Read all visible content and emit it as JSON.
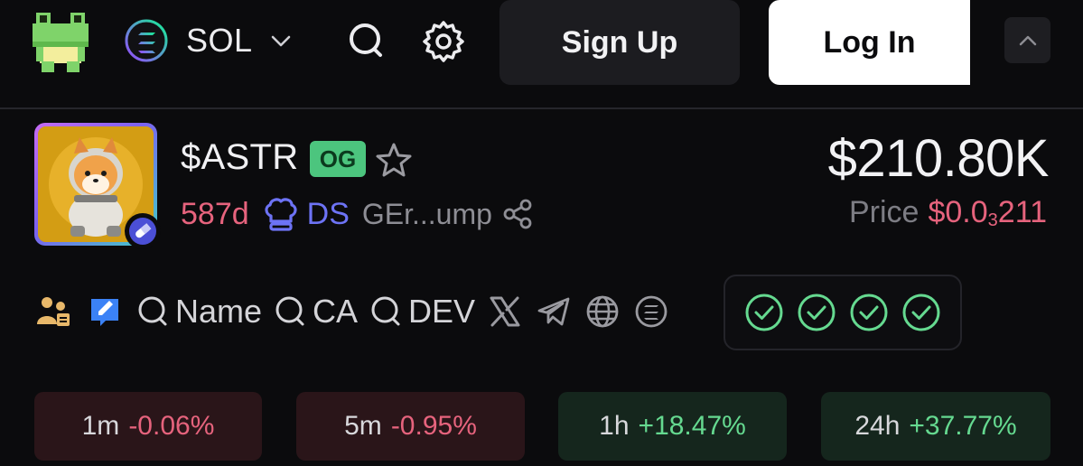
{
  "header": {
    "chain": {
      "label": "SOL",
      "icon": "solana-icon"
    },
    "search_icon": "search-icon",
    "settings_icon": "gear-icon",
    "signup_label": "Sign Up",
    "login_label": "Log In",
    "collapse_icon": "chevron-up-icon"
  },
  "token": {
    "ticker": "$ASTR",
    "badge": "OG",
    "age": "587d",
    "dev_label": "DS",
    "contract": "GEr...ump",
    "market_cap": "$210.80K",
    "price_label": "Price",
    "price_prefix": "$0.0",
    "price_sub": "3",
    "price_suffix": "211"
  },
  "links": {
    "search_name": "Name",
    "search_ca": "CA",
    "search_dev": "DEV",
    "icons": [
      "holders-icon",
      "edit-icon",
      "x-twitter-icon",
      "telegram-icon",
      "globe-icon",
      "solana-icon"
    ],
    "checks_count": 4
  },
  "changes": [
    {
      "period": "1m",
      "value": "-0.06%",
      "trend": "negative"
    },
    {
      "period": "5m",
      "value": "-0.95%",
      "trend": "negative"
    },
    {
      "period": "1h",
      "value": "+18.47%",
      "trend": "positive"
    },
    {
      "period": "24h",
      "value": "+37.77%",
      "trend": "positive"
    }
  ],
  "colors": {
    "background": "#0b0b0d",
    "negative": "#e6637d",
    "positive": "#65d990",
    "og_badge": "#4cc57e",
    "dev_link": "#6d73f5"
  }
}
